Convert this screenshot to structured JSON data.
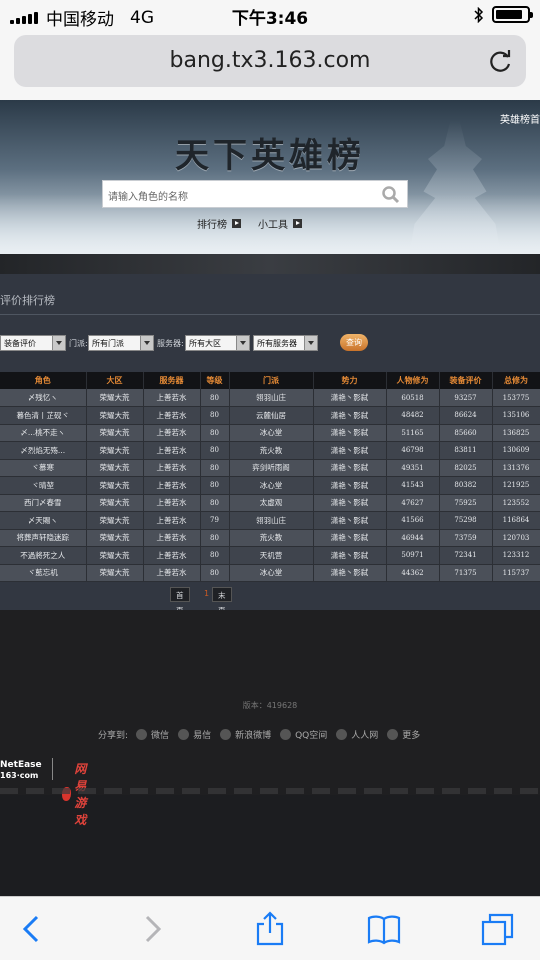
{
  "status_bar": {
    "carrier": "中国移动",
    "network": "4G",
    "time": "下午3:46",
    "battery_level": 0.85
  },
  "browser": {
    "url": "bang.tx3.163.com"
  },
  "hero": {
    "top_link": "英雄榜首",
    "title": "天下英雄榜",
    "search_placeholder": "请输入角色的名称",
    "nav": [
      "排行榜",
      "小工具"
    ]
  },
  "ranking": {
    "title": "评价排行榜",
    "filters": {
      "category_value": "装备评价",
      "school_label": "门派:",
      "school_value": "所有门派",
      "server_label": "服务器:",
      "region_value": "所有大区",
      "server_value": "所有服务器",
      "query_label": "查询"
    },
    "columns": [
      "角色",
      "大区",
      "服务器",
      "等级",
      "门派",
      "势力",
      "人物修为",
      "装备评价",
      "总修为"
    ],
    "rows": [
      [
        "〆残忆ヽ",
        "荣耀大荒",
        "上善若水",
        "80",
        "翎羽山庄",
        "潇艳丶影弑",
        "60518",
        "93257",
        "153775"
      ],
      [
        "暮色清丨芷砚ヾ",
        "荣耀大荒",
        "上善若水",
        "80",
        "云麓仙居",
        "潇艳丶影弑",
        "48482",
        "86624",
        "135106"
      ],
      [
        "〆...桃不走ヽ",
        "荣耀大荒",
        "上善若水",
        "80",
        "冰心堂",
        "潇艳丶影弑",
        "51165",
        "85660",
        "136825"
      ],
      [
        "〆烈焰无殇...",
        "荣耀大荒",
        "上善若水",
        "80",
        "荒火教",
        "潇艳丶影弑",
        "46798",
        "83811",
        "130609"
      ],
      [
        "ヾ慕寒",
        "荣耀大荒",
        "上善若水",
        "80",
        "弈剑听雨阁",
        "潇艳丶影弑",
        "49351",
        "82025",
        "131376"
      ],
      [
        "ヾ晴堃",
        "荣耀大荒",
        "上善若水",
        "80",
        "冰心堂",
        "潇艳丶影弑",
        "41543",
        "80382",
        "121925"
      ],
      [
        "西门〆春雪",
        "荣耀大荒",
        "上善若水",
        "80",
        "太虚观",
        "潇艳丶影弑",
        "47627",
        "75925",
        "123552"
      ],
      [
        "〆天賜ヽ",
        "荣耀大荒",
        "上善若水",
        "79",
        "翎羽山庄",
        "潇艳丶影弑",
        "41566",
        "75298",
        "116864"
      ],
      [
        "将葬声轩隐迷踪",
        "荣耀大荒",
        "上善若水",
        "80",
        "荒火教",
        "潇艳丶影弑",
        "46944",
        "73759",
        "120703"
      ],
      [
        "不過將死之人",
        "荣耀大荒",
        "上善若水",
        "80",
        "天机营",
        "潇艳丶影弑",
        "50971",
        "72341",
        "123312"
      ],
      [
        "ヾ藍忘机",
        "荣耀大荒",
        "上善若水",
        "80",
        "冰心堂",
        "潇艳丶影弑",
        "44362",
        "71375",
        "115737"
      ]
    ],
    "pager": {
      "first": "首页",
      "current": "1",
      "last": "末页"
    }
  },
  "footer": {
    "version": "版本：419628",
    "share_label": "分享到:",
    "share_items": [
      "微信",
      "易信",
      "新浪微博",
      "QQ空间",
      "人人网",
      "更多"
    ],
    "netease_logo_line1": "NetEase",
    "netease_logo_line2": "163·com",
    "game_logo": "网易游戏"
  },
  "icons": [
    "reload-icon",
    "search-icon",
    "back-icon",
    "forward-icon",
    "share-icon",
    "bookmarks-icon",
    "tabs-icon",
    "bluetooth-icon"
  ],
  "colors": {
    "header_text": "#e58a35",
    "row_odd": "#4b5059",
    "row_even": "#3f444d",
    "accent_button": "#e09a4f"
  }
}
